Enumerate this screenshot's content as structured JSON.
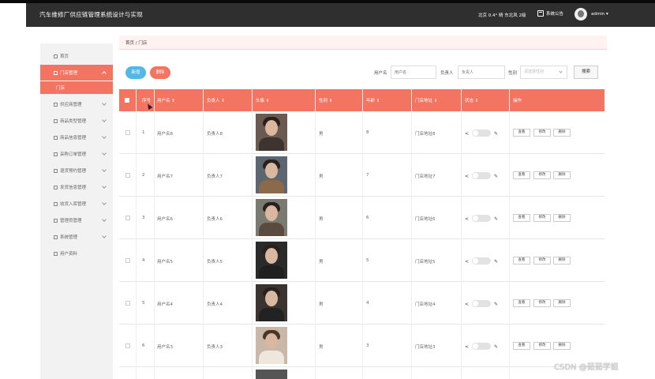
{
  "header": {
    "title": "汽车维修厂供应链管理系统设计与实现",
    "weather": "北京  0.4°  晴  东北风  2级",
    "notice": "系统公告",
    "user": "admin ▾"
  },
  "sidebar": {
    "items": [
      {
        "label": "首页",
        "icon": "home-icon"
      },
      {
        "label": "门店管理",
        "icon": "store-icon",
        "active": true
      },
      {
        "label": "供应商管理",
        "icon": "supplier-icon"
      },
      {
        "label": "商品类型管理",
        "icon": "category-icon"
      },
      {
        "label": "商品信息管理",
        "icon": "chart-icon"
      },
      {
        "label": "采购订单管理",
        "icon": "order-icon"
      },
      {
        "label": "退货预约管理",
        "icon": "return-icon"
      },
      {
        "label": "发货信息管理",
        "icon": "delivery-icon"
      },
      {
        "label": "收货入库管理",
        "icon": "inbound-icon"
      },
      {
        "label": "管理员管理",
        "icon": "admin-icon"
      },
      {
        "label": "系统管理",
        "icon": "settings-icon"
      },
      {
        "label": "用户资料",
        "icon": "profile-icon"
      }
    ],
    "sub_item": "门店"
  },
  "breadcrumb": "首页 / 门店",
  "toolbar": {
    "add_label": "新增",
    "delete_label": "删除",
    "search_label": "搜索"
  },
  "filters": {
    "username_label": "用户名",
    "username_placeholder": "用户名",
    "manager_label": "负责人",
    "manager_placeholder": "负责人",
    "gender_label": "性别",
    "gender_placeholder": "请选择性别"
  },
  "table": {
    "columns": [
      "序号",
      "用户名 ⇕",
      "负责人 ⇕",
      "头像 ⇕",
      "性别 ⇕",
      "年龄 ⇕",
      "门店地址 ⇕",
      "状态 ⇕",
      "操作"
    ],
    "rows": [
      {
        "index": "1",
        "username": "用户名8",
        "manager": "负责人8",
        "gender": "男",
        "age": "8",
        "address": "门店地址8"
      },
      {
        "index": "2",
        "username": "用户名7",
        "manager": "负责人7",
        "gender": "男",
        "age": "7",
        "address": "门店地址7"
      },
      {
        "index": "3",
        "username": "用户名6",
        "manager": "负责人6",
        "gender": "男",
        "age": "6",
        "address": "门店地址6"
      },
      {
        "index": "4",
        "username": "用户名5",
        "manager": "负责人5",
        "gender": "男",
        "age": "5",
        "address": "门店地址5"
      },
      {
        "index": "5",
        "username": "用户名4",
        "manager": "负责人4",
        "gender": "男",
        "age": "4",
        "address": "门店地址4"
      },
      {
        "index": "6",
        "username": "用户名3",
        "manager": "负责人3",
        "gender": "男",
        "age": "3",
        "address": "门店地址3"
      }
    ],
    "action_labels": [
      "查看",
      "修改",
      "删除"
    ]
  },
  "watermark": "CSDN @茹茹学姐",
  "colors": {
    "accent": "#f27461",
    "add_button": "#53b8e8",
    "header": "#2f2f2f"
  }
}
